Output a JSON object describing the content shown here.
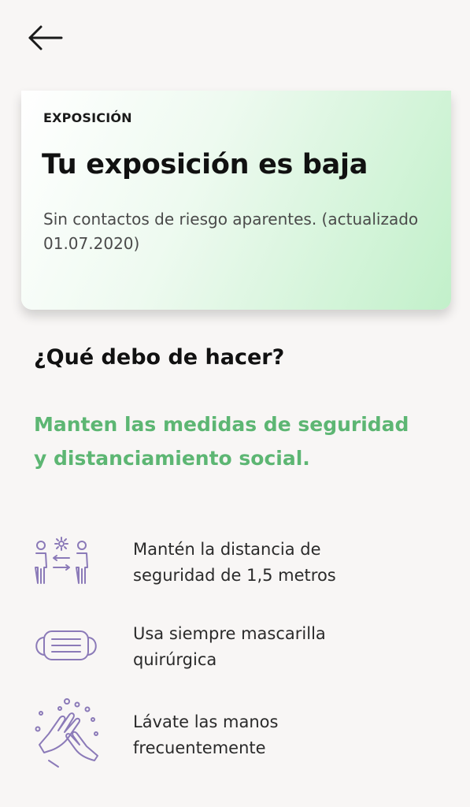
{
  "topbar": {
    "back_icon": "arrow-left-icon"
  },
  "status_card": {
    "label": "EXPOSICIÓN",
    "title": "Tu exposición es baja",
    "description": "Sin contactos de riesgo aparentes. (actualizado 01.07.2020)",
    "gradient_colors": [
      "#ffffff",
      "#eefaf0",
      "#c2f0ca"
    ]
  },
  "section": {
    "title": "¿Qué debo de hacer?",
    "highlight": "Manten las medidas de seguridad y distanciamiento social.",
    "highlight_color": "#5db673"
  },
  "tips": [
    {
      "icon": "social-distance-icon",
      "text": "Mantén la distancia de seguridad de 1,5 metros"
    },
    {
      "icon": "face-mask-icon",
      "text": "Usa siempre mascarilla quirúrgica"
    },
    {
      "icon": "hand-washing-icon",
      "text": "Lávate las manos frecuentemente"
    }
  ],
  "colors": {
    "icon_purple": "#8b7ab8",
    "background": "#f8f6f5"
  }
}
